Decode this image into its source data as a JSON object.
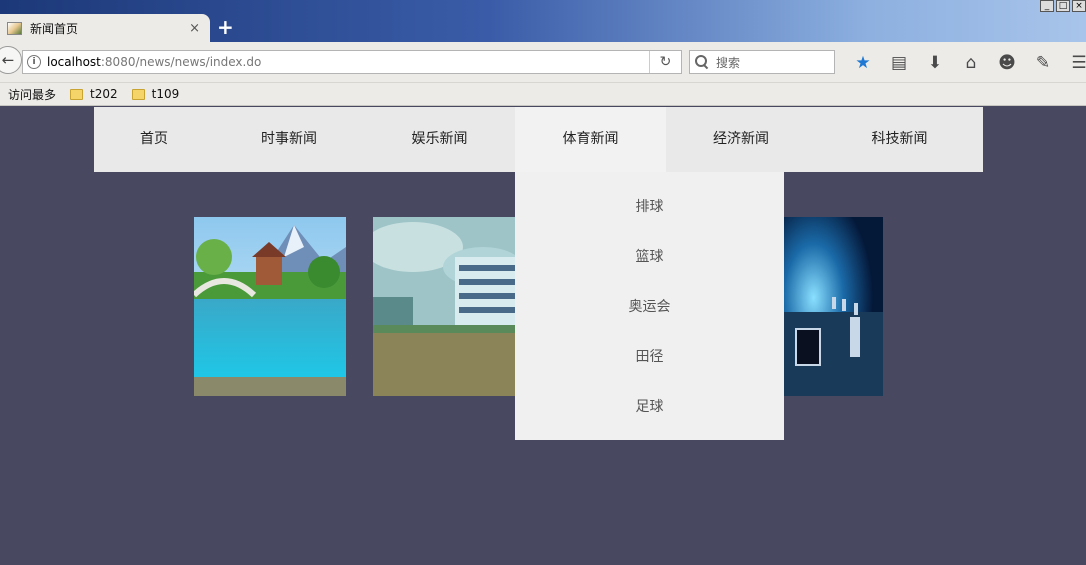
{
  "browser": {
    "tab_title": "新闻首页",
    "new_tab": "+",
    "tab_close": "×",
    "url_host": "localhost",
    "url_rest": ":8080/news/news/index.do",
    "search_placeholder": "搜索",
    "bookmarks": [
      "访问最多",
      "t202",
      "t109"
    ],
    "toolbar_icons": [
      "star-icon",
      "reading-list-icon",
      "download-icon",
      "home-icon",
      "emoji-icon",
      "wrench-icon",
      "menu-icon"
    ]
  },
  "page": {
    "nav": [
      "首页",
      "时事新闻",
      "娱乐新闻",
      "体育新闻",
      "经济新闻",
      "科技新闻"
    ],
    "active_nav": "体育新闻",
    "submenu": [
      "排球",
      "篮球",
      "奥运会",
      "田径",
      "足球"
    ],
    "images": [
      "lake-bridge-image",
      "school-building-image",
      "tech-network-image"
    ]
  },
  "colors": {
    "page_bg": "#484860",
    "menu_bg": "#e9e9e9",
    "submenu_bg": "#f0f0f0",
    "accent_star": "#1e78d4"
  }
}
